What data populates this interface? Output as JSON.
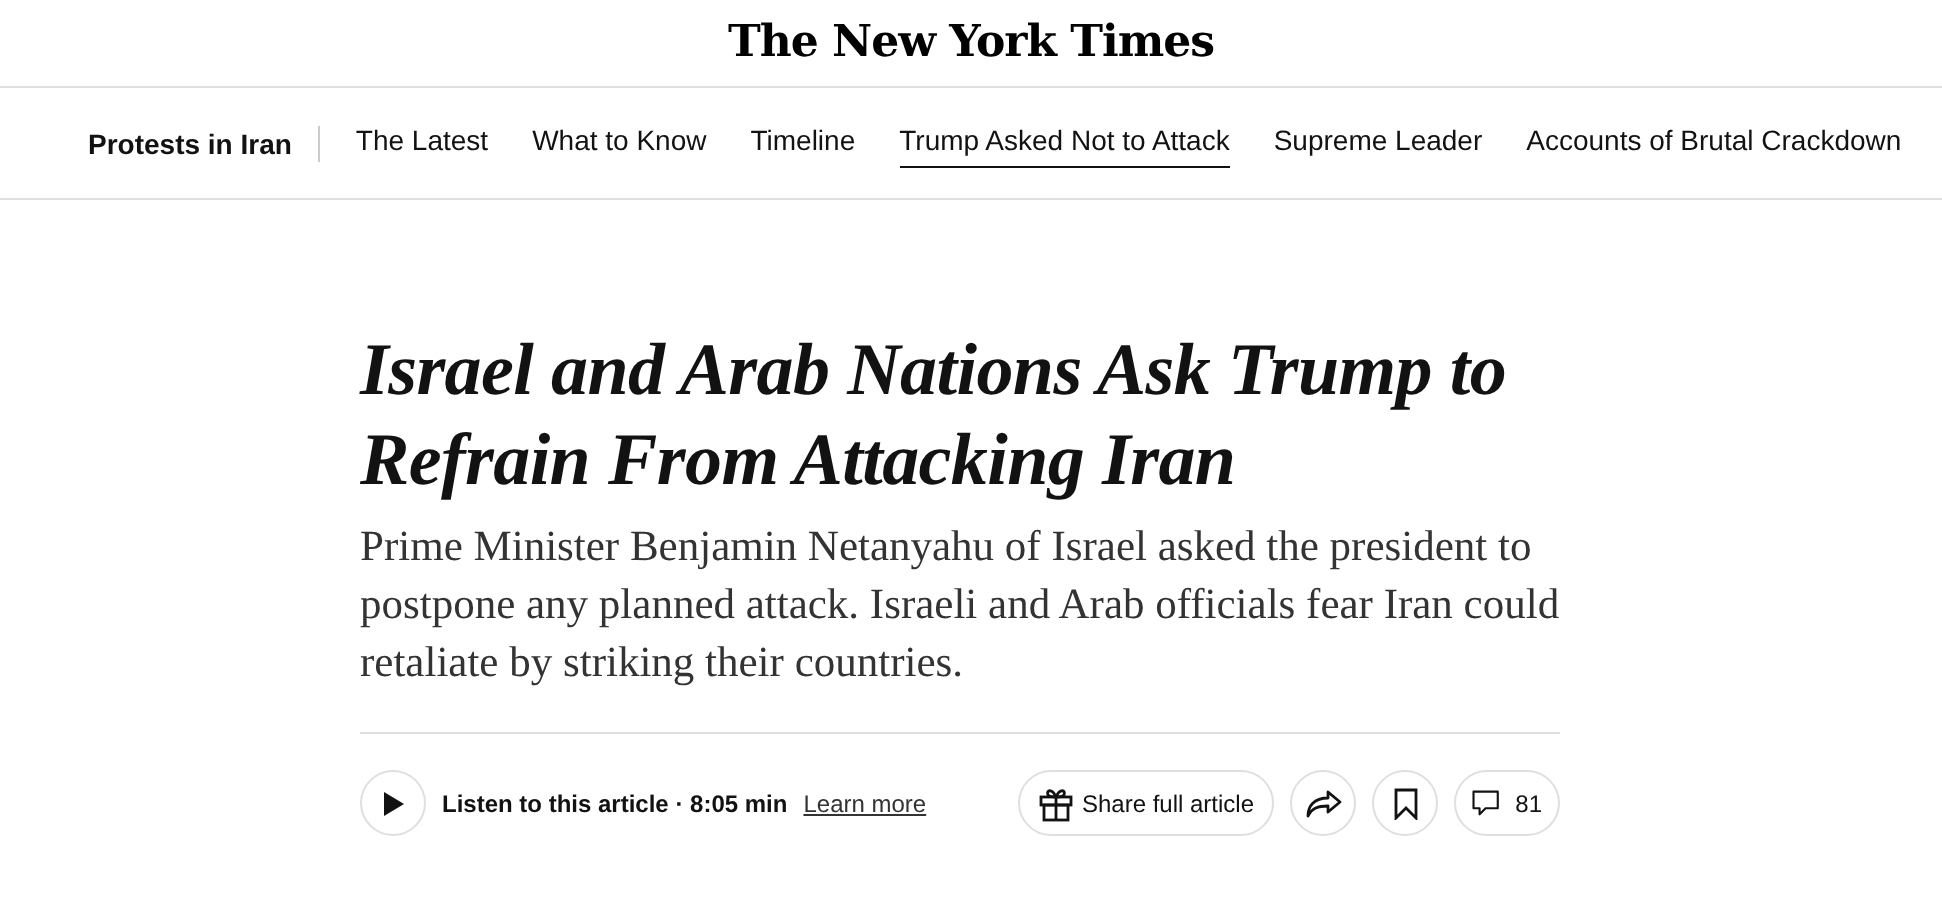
{
  "masthead": {
    "logo": "The New York Times"
  },
  "topic_nav": {
    "title": "Protests in Iran",
    "links": [
      {
        "label": "The Latest",
        "selected": false
      },
      {
        "label": "What to Know",
        "selected": false
      },
      {
        "label": "Timeline",
        "selected": false
      },
      {
        "label": "Trump Asked Not to Attack",
        "selected": true
      },
      {
        "label": "Supreme Leader",
        "selected": false
      },
      {
        "label": "Accounts of Brutal Crackdown",
        "selected": false
      }
    ]
  },
  "article": {
    "headline": "Israel and Arab Nations Ask Trump to Refrain From Attacking Iran",
    "summary": "Prime Minister Benjamin Netanyahu of Israel asked the president to postpone any planned attack. Israeli and Arab officials fear Iran could retaliate by striking their countries."
  },
  "toolbar": {
    "listen": "Listen to this article · 8:05 min",
    "learn_more": "Learn more",
    "share": "Share full article",
    "comments": "81"
  }
}
